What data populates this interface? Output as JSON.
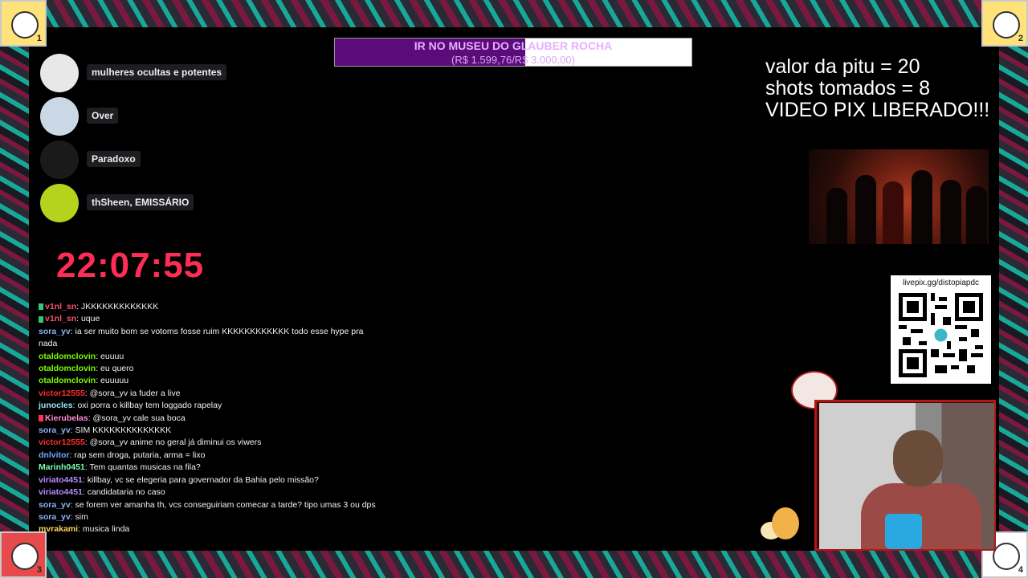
{
  "goal": {
    "title": "IR NO MUSEU DO GLAUBER ROCHA",
    "amount": "(R$ 1.599,76/R$ 3.000,00)",
    "progress": 0.533,
    "fill_color": "#5b0b7a"
  },
  "stats": {
    "line1": "valor da pitu = 20",
    "line2": "shots tomados = 8",
    "line3": "VIDEO PIX LIBERADO!!!"
  },
  "voice": [
    {
      "name": "mulheres ocultas e potentes"
    },
    {
      "name": "Over"
    },
    {
      "name": "Paradoxo"
    },
    {
      "name": "thSheen, EMISSÁRIO"
    }
  ],
  "clock": "22:07:55",
  "corners": [
    "1",
    "2",
    "3",
    "4"
  ],
  "chat": [
    {
      "user": "v1nl_sn",
      "color": "#ff4d6d",
      "badge": "#2ecc71",
      "text": "JKKKKKKKKKKKKK"
    },
    {
      "user": "v1nl_sn",
      "color": "#ff4d6d",
      "badge": "#2ecc71",
      "text": "uque"
    },
    {
      "user": "sora_yv",
      "color": "#8ab4f8",
      "badge": "",
      "text": "ia ser muito bom se votoms fosse ruim KKKKKKKKKKKK todo esse hype pra nada"
    },
    {
      "user": "otaldomclovin",
      "color": "#7cfc00",
      "badge": "",
      "text": "euuuu"
    },
    {
      "user": "otaldomclovin",
      "color": "#7cfc00",
      "badge": "",
      "text": "eu quero"
    },
    {
      "user": "otaldomclovin",
      "color": "#7cfc00",
      "badge": "",
      "text": "euuuuu"
    },
    {
      "user": "victor12555",
      "color": "#ff2d2d",
      "badge": "",
      "text": "@sora_yv ia fuder a live"
    },
    {
      "user": "junocles",
      "color": "#9be7ff",
      "badge": "",
      "text": "oxi porra o killbay tem loggado rapelay"
    },
    {
      "user": "Kierubelas",
      "color": "#ff8ad0",
      "badge": "#ff3355",
      "text": "@sora_yv cale sua boca"
    },
    {
      "user": "sora_yv",
      "color": "#8ab4f8",
      "badge": "",
      "text": "SIM KKKKKKKKKKKKKK"
    },
    {
      "user": "victor12555",
      "color": "#ff2d2d",
      "badge": "",
      "text": "@sora_yv anime no geral já diminui os viwers"
    },
    {
      "user": "dnlvitor",
      "color": "#6fa8ff",
      "badge": "",
      "text": "rap sem droga, putaria, arma = lixo"
    },
    {
      "user": "Marinh0451",
      "color": "#7cfcb0",
      "badge": "",
      "text": "Tem quantas musicas na fila?"
    },
    {
      "user": "viriato4451",
      "color": "#b88cff",
      "badge": "",
      "text": "killbay, vc se elegeria para governador da Bahia pelo missão?"
    },
    {
      "user": "viriato4451",
      "color": "#b88cff",
      "badge": "",
      "text": "candidataria no caso"
    },
    {
      "user": "sora_yv",
      "color": "#8ab4f8",
      "badge": "",
      "text": "se forem ver amanha th, vcs conseguiriam comecar a tarde? tipo umas 3 ou dps"
    },
    {
      "user": "sora_yv",
      "color": "#8ab4f8",
      "badge": "",
      "text": "sim"
    },
    {
      "user": "mvrakami",
      "color": "#ffd35a",
      "badge": "",
      "text": "musica linda"
    }
  ],
  "qr": {
    "label": "livepix.gg/distopiapdc"
  }
}
